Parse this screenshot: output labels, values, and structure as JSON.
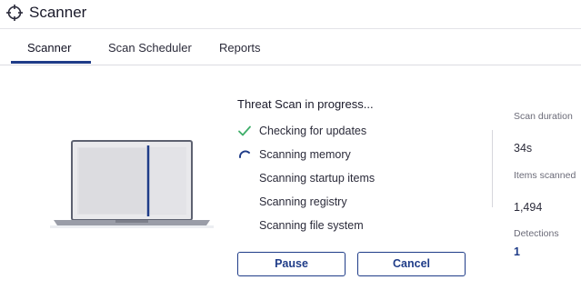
{
  "app": {
    "title": "Scanner",
    "icon": "crosshair-icon"
  },
  "tabs": [
    {
      "label": "Scanner",
      "active": true
    },
    {
      "label": "Scan Scheduler",
      "active": false
    },
    {
      "label": "Reports",
      "active": false
    }
  ],
  "scan": {
    "title": "Threat Scan in progress...",
    "steps": [
      {
        "label": "Checking for updates",
        "status": "done",
        "icon": "check-icon"
      },
      {
        "label": "Scanning memory",
        "status": "in-progress",
        "icon": "spinner-icon"
      },
      {
        "label": "Scanning startup items",
        "status": "pending"
      },
      {
        "label": "Scanning registry",
        "status": "pending"
      },
      {
        "label": "Scanning file system",
        "status": "pending"
      }
    ]
  },
  "stats": {
    "duration_label": "Scan duration",
    "duration_value": "34s",
    "items_label": "Items scanned",
    "items_value": "1,494",
    "detections_label": "Detections",
    "detections_value": "1"
  },
  "buttons": {
    "pause": "Pause",
    "cancel": "Cancel"
  },
  "colors": {
    "accent": "#1f3c88",
    "check": "#3fae6a",
    "divider": "#d6d6dc"
  }
}
